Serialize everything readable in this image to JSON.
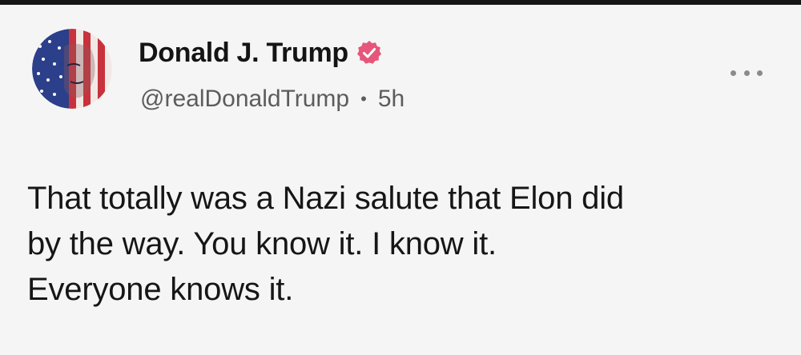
{
  "author": {
    "display_name": "Donald J. Trump",
    "handle": "@realDonaldTrump",
    "separator": "•",
    "time_ago": "5h",
    "verified": true,
    "badge_color": "#e6567a"
  },
  "post": {
    "text": "That totally was a Nazi salute that Elon did\nby the way. You know it. I know it.\nEveryone knows it."
  },
  "icons": {
    "avatar": "flag-face-avatar",
    "verified": "verified-badge-icon",
    "more": "more-options-icon"
  },
  "colors": {
    "background": "#f5f5f5",
    "text": "#161616",
    "secondary_text": "#5c5c5c"
  }
}
